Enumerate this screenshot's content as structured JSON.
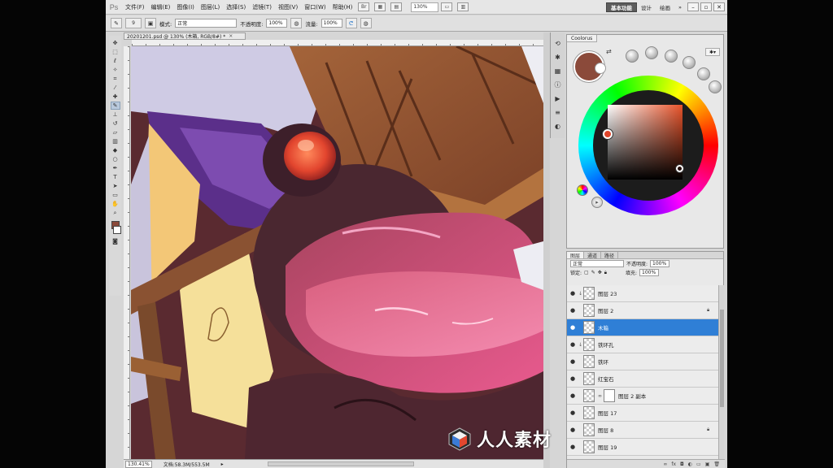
{
  "menubar": {
    "logo": "Ps",
    "items": [
      "文件(F)",
      "编辑(E)",
      "图像(I)",
      "图层(L)",
      "选择(S)",
      "滤镜(T)",
      "视图(V)",
      "窗口(W)",
      "帮助(H)"
    ],
    "zoom": "130%",
    "workspaces": [
      "基本功能",
      "设计",
      "绘画"
    ],
    "active_workspace": "基本功能"
  },
  "options": {
    "brush_size": "9",
    "mode_label": "模式:",
    "mode_value": "正常",
    "opacity_label": "不透明度:",
    "opacity_value": "100%",
    "flow_label": "流量:",
    "flow_value": "100%"
  },
  "document": {
    "tab_title": "20201201.psd @ 130% (木箱, RGB/8#) *",
    "zoom": "130.41%",
    "doc_info": "文档:58.3M/553.5M"
  },
  "coolorus": {
    "tab": "Coolorus",
    "current_color": "#8b4a3a"
  },
  "layers": {
    "tabs": [
      "图层",
      "通道",
      "路径"
    ],
    "blend_mode": "正常",
    "opacity_label": "不透明度:",
    "opacity_value": "100%",
    "lock_label": "锁定:",
    "fill_label": "填充:",
    "fill_value": "100%",
    "items": [
      {
        "name": "图层 23",
        "selected": false
      },
      {
        "name": "图层 2",
        "selected": false
      },
      {
        "name": "木箱",
        "selected": true
      },
      {
        "name": "铁环孔",
        "selected": false
      },
      {
        "name": "铁环",
        "selected": false
      },
      {
        "name": "红宝石",
        "selected": false
      },
      {
        "name": "图层 2 副本",
        "selected": false
      },
      {
        "name": "图层 17",
        "selected": false
      },
      {
        "name": "图层 8",
        "selected": false
      },
      {
        "name": "图层 19",
        "selected": false
      }
    ]
  },
  "watermark": {
    "text": "人人素材"
  }
}
